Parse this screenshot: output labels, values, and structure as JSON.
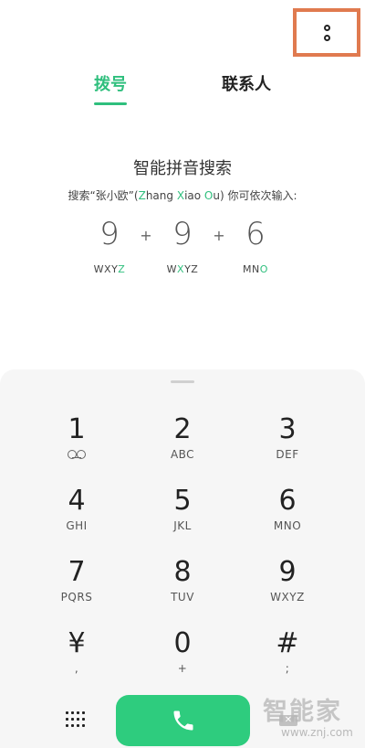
{
  "header": {
    "more_icon": "more-vertical-icon",
    "highlight_color": "#e07a4f"
  },
  "tabs": [
    {
      "label": "拨号",
      "active": true
    },
    {
      "label": "联系人",
      "active": false
    }
  ],
  "hint": {
    "title": "智能拼音搜索",
    "sub_prefix": "搜索“张小欧”(",
    "sub_z": "Z",
    "sub_hang": "hang ",
    "sub_x": "X",
    "sub_iao": "iao ",
    "sub_o": "O",
    "sub_u": "u",
    "sub_suffix": ") 你可依次输入:"
  },
  "example": [
    {
      "digit": "9",
      "letters_pre": "WXY",
      "letters_hi": "Z",
      "letters_post": ""
    },
    {
      "digit": "9",
      "letters_pre": "W",
      "letters_hi": "X",
      "letters_post": "YZ"
    },
    {
      "digit": "6",
      "letters_pre": "MN",
      "letters_hi": "O",
      "letters_post": ""
    }
  ],
  "example_plus": "+",
  "keypad": [
    {
      "digit": "1",
      "letters": ""
    },
    {
      "digit": "2",
      "letters": "ABC"
    },
    {
      "digit": "3",
      "letters": "DEF"
    },
    {
      "digit": "4",
      "letters": "GHI"
    },
    {
      "digit": "5",
      "letters": "JKL"
    },
    {
      "digit": "6",
      "letters": "MNO"
    },
    {
      "digit": "7",
      "letters": "PQRS"
    },
    {
      "digit": "8",
      "letters": "TUV"
    },
    {
      "digit": "9",
      "letters": "WXYZ"
    },
    {
      "digit": "¥",
      "letters": ","
    },
    {
      "digit": "0",
      "letters": "+"
    },
    {
      "digit": "#",
      "letters": ";"
    }
  ],
  "call_color": "#2ecc7e",
  "accent_color": "#2fbf7d",
  "watermark": {
    "text": "智能家",
    "url": "www.znj.com"
  }
}
